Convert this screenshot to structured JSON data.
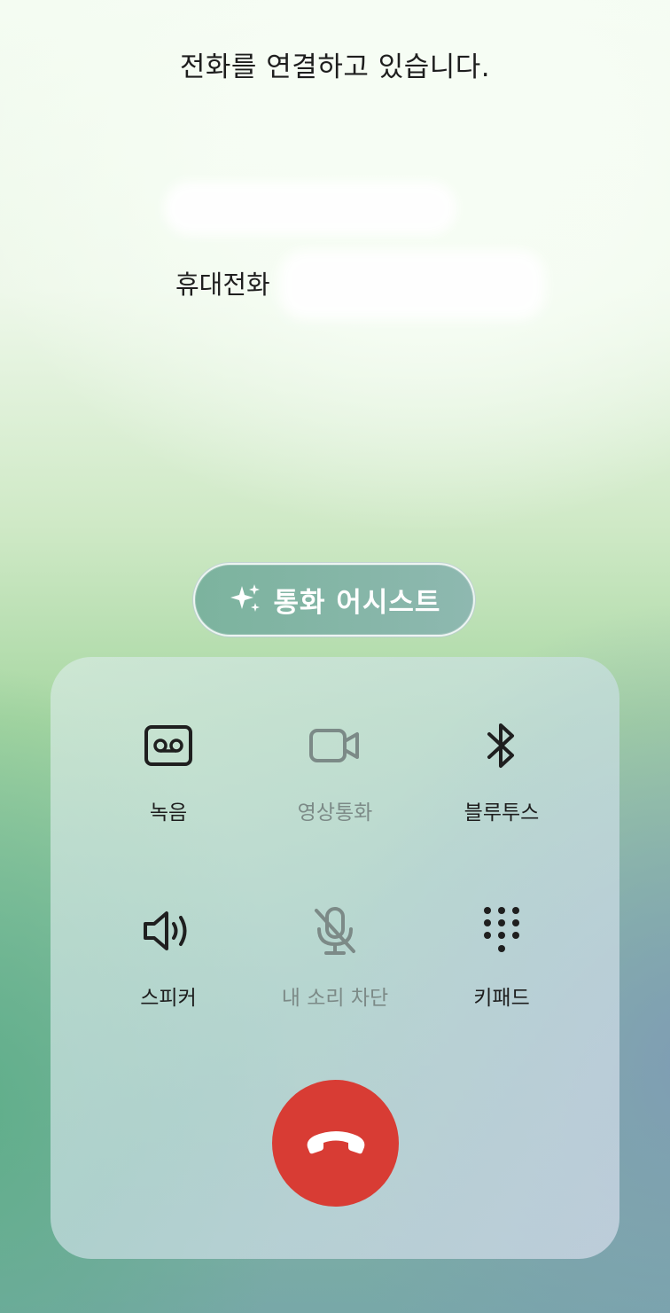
{
  "call": {
    "status": "전화를 연결하고 있습니다.",
    "number_label": "휴대전화"
  },
  "assist": {
    "label": "통화 어시스트",
    "icon": "sparkle-icon"
  },
  "controls": [
    {
      "label": "녹음",
      "icon": "voicemail-record-icon",
      "enabled": true
    },
    {
      "label": "영상통화",
      "icon": "video-camera-icon",
      "enabled": false
    },
    {
      "label": "블루투스",
      "icon": "bluetooth-icon",
      "enabled": true
    },
    {
      "label": "스피커",
      "icon": "speaker-icon",
      "enabled": true
    },
    {
      "label": "내 소리 차단",
      "icon": "mic-off-icon",
      "enabled": false
    },
    {
      "label": "키패드",
      "icon": "dialpad-icon",
      "enabled": true
    }
  ],
  "end_call": {
    "icon": "end-call-icon",
    "color": "#d83c34"
  },
  "colors": {
    "accent_green": "#86b6a8",
    "end_call_red": "#d83c34",
    "disabled": "#7c8a87"
  }
}
